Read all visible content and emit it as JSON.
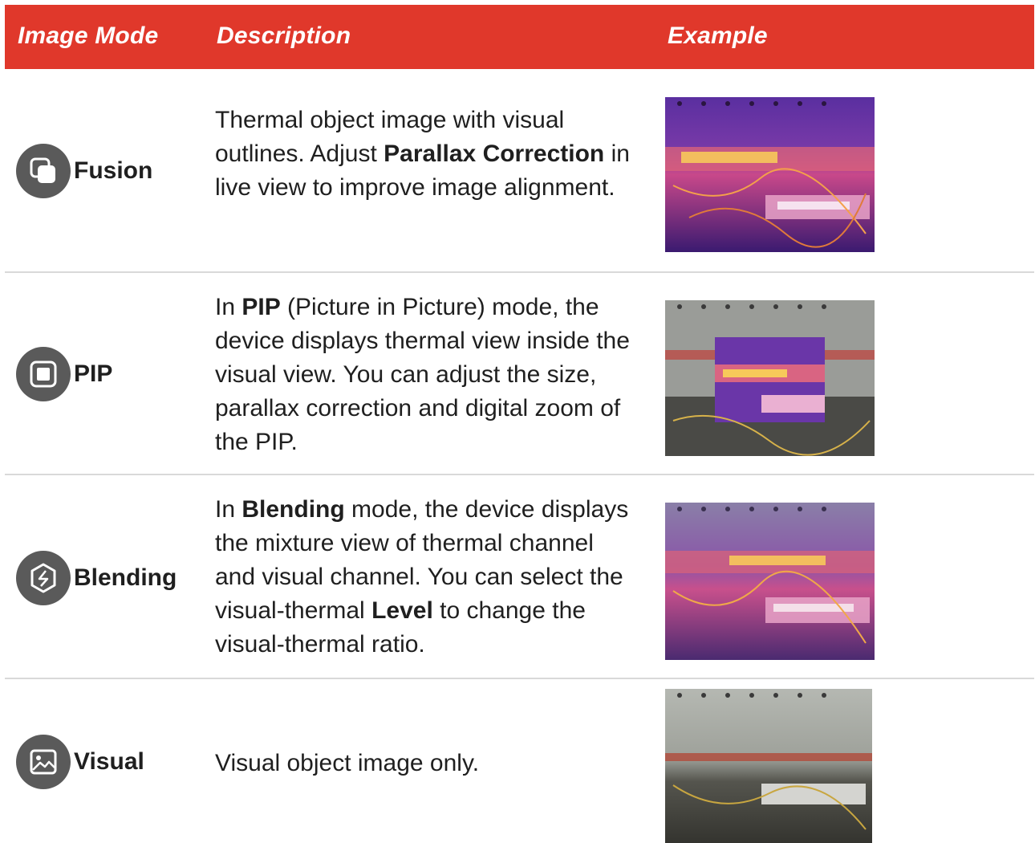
{
  "header": {
    "col_mode": "Image Mode",
    "col_description": "Description",
    "col_example": "Example",
    "background_color": "#e0382b"
  },
  "rows": [
    {
      "mode": "Fusion",
      "icon": "fusion-icon",
      "description": [
        {
          "text": "Thermal object image with visual outlines. Adjust "
        },
        {
          "text": "Parallax Correction",
          "bold": true
        },
        {
          "text": " in live view to improve image alignment."
        }
      ],
      "example": "thermal-fusion-image"
    },
    {
      "mode": "PIP",
      "icon": "pip-icon",
      "description": [
        {
          "text": "In "
        },
        {
          "text": "PIP",
          "bold": true
        },
        {
          "text": " (Picture in Picture) mode, the device displays thermal view inside the visual view. You can adjust the size, parallax correction and digital zoom of the PIP."
        }
      ],
      "example": "pip-image"
    },
    {
      "mode": "Blending",
      "icon": "blending-icon",
      "description": [
        {
          "text": "In "
        },
        {
          "text": "Blending",
          "bold": true
        },
        {
          "text": " mode, the device displays the mixture view of thermal channel and visual channel. You can select the visual-thermal "
        },
        {
          "text": "Level",
          "bold": true
        },
        {
          "text": " to change the visual-thermal ratio."
        }
      ],
      "example": "blending-image"
    },
    {
      "mode": "Visual",
      "icon": "image-icon",
      "description": [
        {
          "text": "Visual object image only."
        }
      ],
      "example": "visual-image"
    }
  ]
}
